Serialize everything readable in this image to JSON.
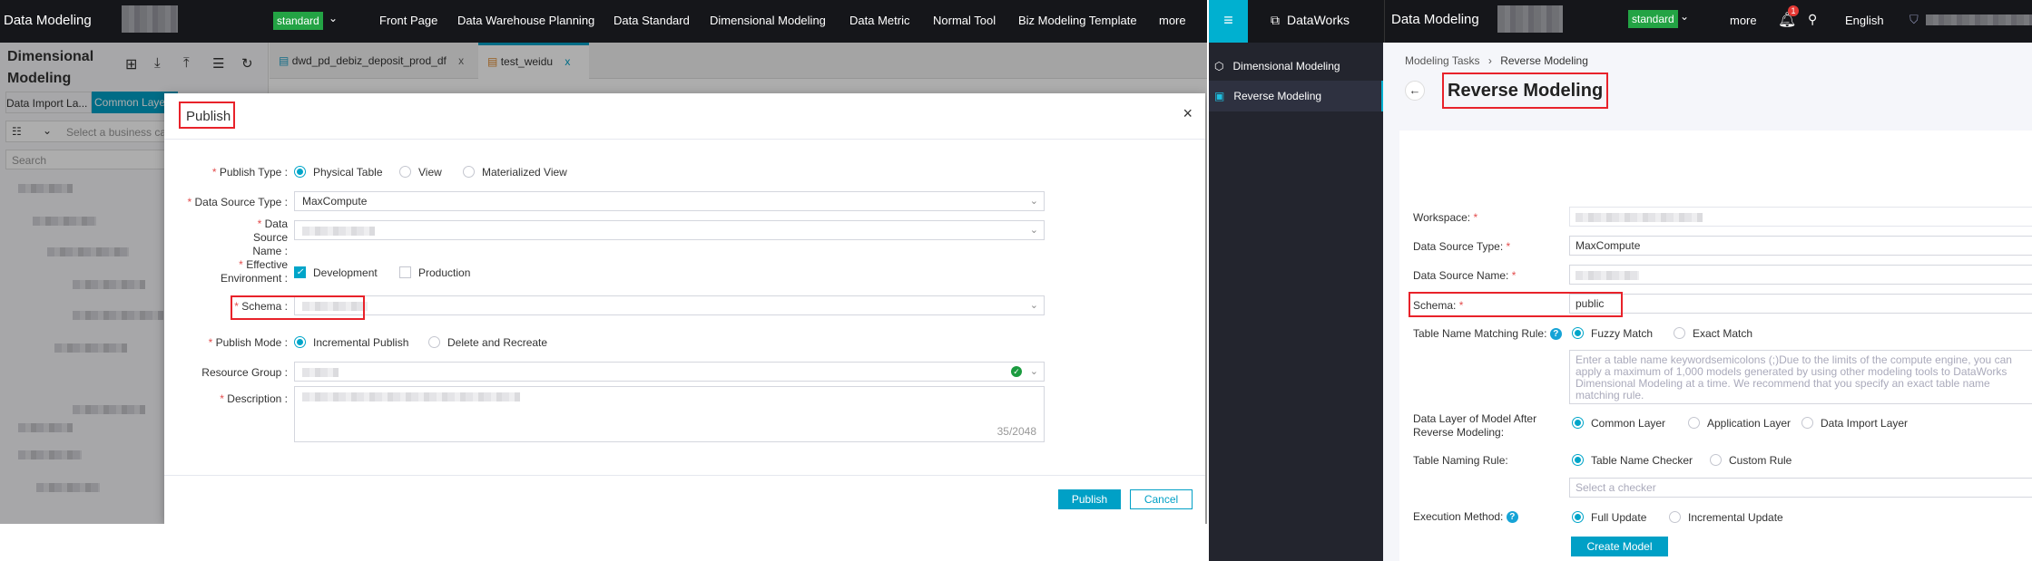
{
  "left": {
    "topbar": {
      "app_title": "Data Modeling",
      "env_badge": "standard",
      "nav": [
        "Front Page",
        "Data Warehouse Planning",
        "Data Standard",
        "Dimensional Modeling",
        "Data Metric",
        "Normal Tool",
        "Biz Modeling Template",
        "more"
      ]
    },
    "sidebar": {
      "title": "Dimensional Modeling",
      "tabs": [
        "Data Import La...",
        "Common Layer"
      ],
      "category_placeholder": "Select a business ca",
      "search_placeholder": "Search"
    },
    "tabs": [
      {
        "label": "dwd_pd_debiz_deposit_prod_df",
        "close": "x"
      },
      {
        "label": "test_weidu",
        "close": "x"
      }
    ],
    "dialog": {
      "title": "Publish",
      "close": "×",
      "publish_type": {
        "label": "Publish Type :",
        "options": [
          "Physical Table",
          "View",
          "Materialized View"
        ],
        "selected": "Physical Table"
      },
      "data_source_type": {
        "label": "Data Source Type :",
        "value": "MaxCompute"
      },
      "data_source_name": {
        "label": "Data Source Name :"
      },
      "effective_env": {
        "label": "Effective Environment :",
        "options": [
          {
            "label": "Development",
            "checked": true
          },
          {
            "label": "Production",
            "checked": false
          }
        ]
      },
      "schema": {
        "label": "Schema :"
      },
      "publish_mode": {
        "label": "Publish Mode :",
        "options": [
          "Incremental Publish",
          "Delete and Recreate"
        ],
        "selected": "Incremental Publish"
      },
      "resource_group": {
        "label": "Resource Group :"
      },
      "description": {
        "label": "Description :",
        "counter": "35/2048"
      },
      "publish_button": "Publish",
      "cancel_button": "Cancel"
    }
  },
  "right": {
    "topbar": {
      "brand": "DataWorks",
      "app_title": "Data Modeling",
      "env_badge": "standard",
      "more": "more",
      "notification_count": "1",
      "language": "English"
    },
    "sidebar": {
      "items": [
        {
          "label": "Dimensional Modeling",
          "icon": "cube-icon"
        },
        {
          "label": "Reverse Modeling",
          "icon": "reverse-icon",
          "active": true
        }
      ]
    },
    "breadcrumb": [
      "Modeling Tasks",
      "Reverse Modeling"
    ],
    "page_title": "Reverse Modeling",
    "form": {
      "workspace_label": "Workspace:",
      "ds_type_label": "Data Source Type:",
      "ds_type_value": "MaxCompute",
      "ds_name_label": "Data Source Name:",
      "schema_label": "Schema:",
      "schema_value": "public",
      "matching_label": "Table Name Matching Rule:",
      "matching_options": [
        "Fuzzy Match",
        "Exact Match"
      ],
      "matching_placeholder": "Enter a table name keywordsemicolons (;)Due to the limits of the compute engine, you can apply a maximum of 1,000 models generated by using other modeling tools to DataWorks Dimensional Modeling at a time. We recommend that you specify an exact table name matching rule.",
      "layer_label": "Data Layer of Model After Reverse Modeling:",
      "layer_options": [
        "Common Layer",
        "Application Layer",
        "Data Import Layer"
      ],
      "naming_label": "Table Naming Rule:",
      "naming_options": [
        "Table Name Checker",
        "Custom Rule"
      ],
      "checker_placeholder": "Select a checker",
      "exec_label": "Execution Method:",
      "exec_options": [
        "Full Update",
        "Incremental Update"
      ],
      "create_button": "Create Model"
    }
  },
  "colors": {
    "accent": "#00a0c6",
    "highlight": "#e8222a",
    "env_badge": "#23a344",
    "topbar": "#15161a"
  }
}
